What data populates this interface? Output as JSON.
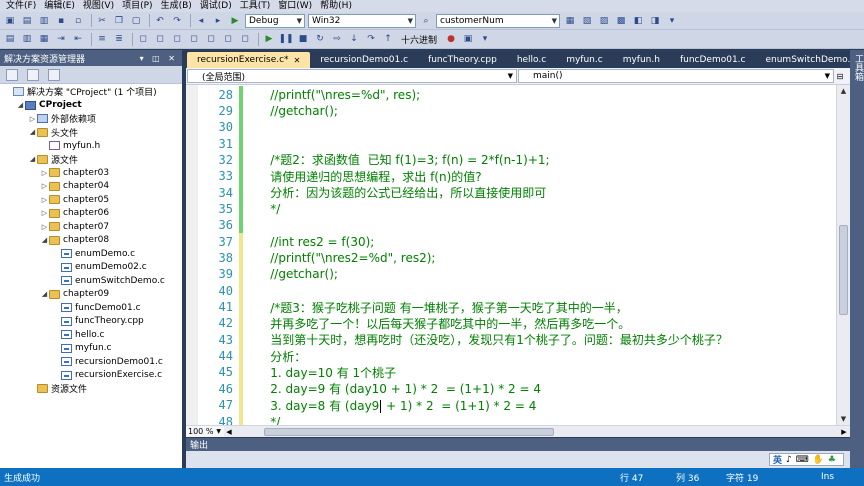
{
  "menu": [
    "文件(F)",
    "编辑(E)",
    "视图(V)",
    "项目(P)",
    "生成(B)",
    "调试(D)",
    "工具(T)",
    "窗口(W)",
    "帮助(H)"
  ],
  "toolbar": {
    "config": "Debug",
    "platform": "Win32",
    "find_value": "customerNum",
    "hex_label": "十六进制"
  },
  "solution_explorer": {
    "title": "解决方案资源管理器",
    "items": [
      {
        "label": "解决方案 \"CProject\" (1 个项目)",
        "type": "sln",
        "indent": 0,
        "expander": ""
      },
      {
        "label": "CProject",
        "type": "proj",
        "indent": 1,
        "expander": "◢",
        "bold": true
      },
      {
        "label": "外部依赖项",
        "type": "ref",
        "indent": 2,
        "expander": "▷"
      },
      {
        "label": "头文件",
        "type": "folder",
        "indent": 2,
        "expander": "◢"
      },
      {
        "label": "myfun.h",
        "type": "hfile",
        "indent": 3,
        "expander": ""
      },
      {
        "label": "源文件",
        "type": "folder",
        "indent": 2,
        "expander": "◢"
      },
      {
        "label": "chapter03",
        "type": "folder",
        "indent": 3,
        "expander": "▷"
      },
      {
        "label": "chapter04",
        "type": "folder",
        "indent": 3,
        "expander": "▷"
      },
      {
        "label": "chapter05",
        "type": "folder",
        "indent": 3,
        "expander": "▷"
      },
      {
        "label": "chapter06",
        "type": "folder",
        "indent": 3,
        "expander": "▷"
      },
      {
        "label": "chapter07",
        "type": "folder",
        "indent": 3,
        "expander": "▷"
      },
      {
        "label": "chapter08",
        "type": "folder",
        "indent": 3,
        "expander": "◢"
      },
      {
        "label": "enumDemo.c",
        "type": "cfile",
        "indent": 4,
        "expander": ""
      },
      {
        "label": "enumDemo02.c",
        "type": "cfile",
        "indent": 4,
        "expander": ""
      },
      {
        "label": "enumSwitchDemo.c",
        "type": "cfile",
        "indent": 4,
        "expander": ""
      },
      {
        "label": "chapter09",
        "type": "folder",
        "indent": 3,
        "expander": "◢"
      },
      {
        "label": "funcDemo01.c",
        "type": "cfile",
        "indent": 4,
        "expander": ""
      },
      {
        "label": "funcTheory.cpp",
        "type": "cfile",
        "indent": 4,
        "expander": ""
      },
      {
        "label": "hello.c",
        "type": "cfile",
        "indent": 4,
        "expander": ""
      },
      {
        "label": "myfun.c",
        "type": "cfile",
        "indent": 4,
        "expander": ""
      },
      {
        "label": "recursionDemo01.c",
        "type": "cfile",
        "indent": 4,
        "expander": ""
      },
      {
        "label": "recursionExercise.c",
        "type": "cfile",
        "indent": 4,
        "expander": ""
      },
      {
        "label": "资源文件",
        "type": "folder",
        "indent": 2,
        "expander": ""
      }
    ]
  },
  "tabs": [
    {
      "label": "recursionExercise.c*",
      "active": true
    },
    {
      "label": "recursionDemo01.c",
      "active": false
    },
    {
      "label": "funcTheory.cpp",
      "active": false
    },
    {
      "label": "hello.c",
      "active": false
    },
    {
      "label": "myfun.c",
      "active": false
    },
    {
      "label": "myfun.h",
      "active": false
    },
    {
      "label": "funcDemo01.c",
      "active": false
    },
    {
      "label": "enumSwitchDemo.c",
      "active": false
    }
  ],
  "nav": {
    "scope": "(全局范围)",
    "function": "main()"
  },
  "code_lines": [
    {
      "n": "28",
      "text": "    //printf(\"\\nres=%d\", res);",
      "mark": "green"
    },
    {
      "n": "29",
      "text": "    //getchar();",
      "mark": "green"
    },
    {
      "n": "30",
      "text": "",
      "mark": "green"
    },
    {
      "n": "31",
      "text": "",
      "mark": "green"
    },
    {
      "n": "32",
      "text": "    /*题2：求函数值  已知 f(1)=3; f(n) = 2*f(n-1)+1;",
      "mark": "green"
    },
    {
      "n": "33",
      "text": "    请使用递归的思想编程，求出 f(n)的值?",
      "mark": "green"
    },
    {
      "n": "34",
      "text": "    分析：因为该题的公式已经给出，所以直接使用即可",
      "mark": "green"
    },
    {
      "n": "35",
      "text": "    */",
      "mark": "green"
    },
    {
      "n": "36",
      "text": "",
      "mark": "green"
    },
    {
      "n": "37",
      "text": "    //int res2 = f(30);",
      "mark": "yellow"
    },
    {
      "n": "38",
      "text": "    //printf(\"\\nres2=%d\", res2);",
      "mark": "yellow"
    },
    {
      "n": "39",
      "text": "    //getchar();",
      "mark": "yellow"
    },
    {
      "n": "40",
      "text": "",
      "mark": "yellow"
    },
    {
      "n": "41",
      "text": "    /*题3：猴子吃桃子问题 有一堆桃子，猴子第一天吃了其中的一半，",
      "mark": "yellow"
    },
    {
      "n": "42",
      "text": "    并再多吃了一个！以后每天猴子都吃其中的一半，然后再多吃一个。",
      "mark": "yellow"
    },
    {
      "n": "43",
      "text": "    当到第十天时，想再吃时（还没吃），发现只有1个桃子了。问题：最初共多少个桃子？",
      "mark": "yellow"
    },
    {
      "n": "44",
      "text": "    分析：",
      "mark": "yellow"
    },
    {
      "n": "45",
      "text": "    1. day=10 有 1个桃子",
      "mark": "yellow"
    },
    {
      "n": "46",
      "text": "    2. day=9 有 (day10 + 1) * 2  = (1+1) * 2 = 4",
      "mark": "yellow"
    },
    {
      "n": "47",
      "text": "    3. day=8 有 (day9 + 1) * 2  = (1+1) * 2 = 4",
      "mark": "yellow",
      "caret_after": "(day9"
    },
    {
      "n": "48",
      "text": "    */",
      "mark": "yellow"
    }
  ],
  "editor_bottom": {
    "zoom": "100 %"
  },
  "right_strip": {
    "label": "工具箱"
  },
  "output": {
    "title": "输出",
    "ime": [
      "英",
      "♪",
      "⌨",
      "✋",
      "♣"
    ]
  },
  "status": {
    "text": "生成成功",
    "row": "行 47",
    "col": "列 36",
    "char": "字符 19",
    "mode": "Ins"
  }
}
